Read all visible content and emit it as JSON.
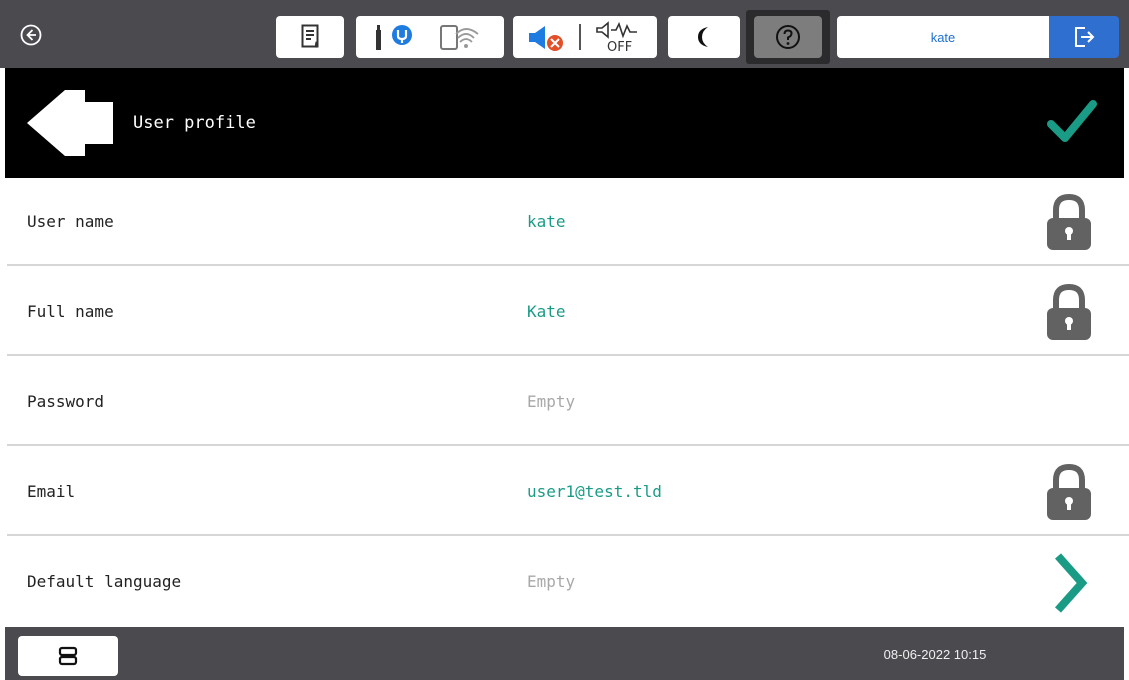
{
  "topbar": {
    "user": "kate",
    "speaker_off_text": "OFF",
    "icons": [
      "back-circle-icon",
      "document-icon",
      "ink-status-icon",
      "wifi-direct-icon",
      "mute-icon",
      "sound-off-icon",
      "sleep-icon",
      "help-icon",
      "logout-icon"
    ]
  },
  "header": {
    "title": "User profile"
  },
  "rows": [
    {
      "label": "User name",
      "value": "kate",
      "status": "locked"
    },
    {
      "label": "Full name",
      "value": "Kate",
      "status": "locked"
    },
    {
      "label": "Password",
      "value": "Empty",
      "status": "editable"
    },
    {
      "label": "Email",
      "value": "user1@test.tld",
      "status": "locked"
    },
    {
      "label": "Default language",
      "value": "Empty",
      "status": "navigate"
    }
  ],
  "footer": {
    "datetime": "08-06-2022 10:15"
  },
  "colors": {
    "accent": "#1a9b86",
    "topbar": "#4a4a4f",
    "header": "#000000",
    "logout": "#2f6fcf"
  }
}
